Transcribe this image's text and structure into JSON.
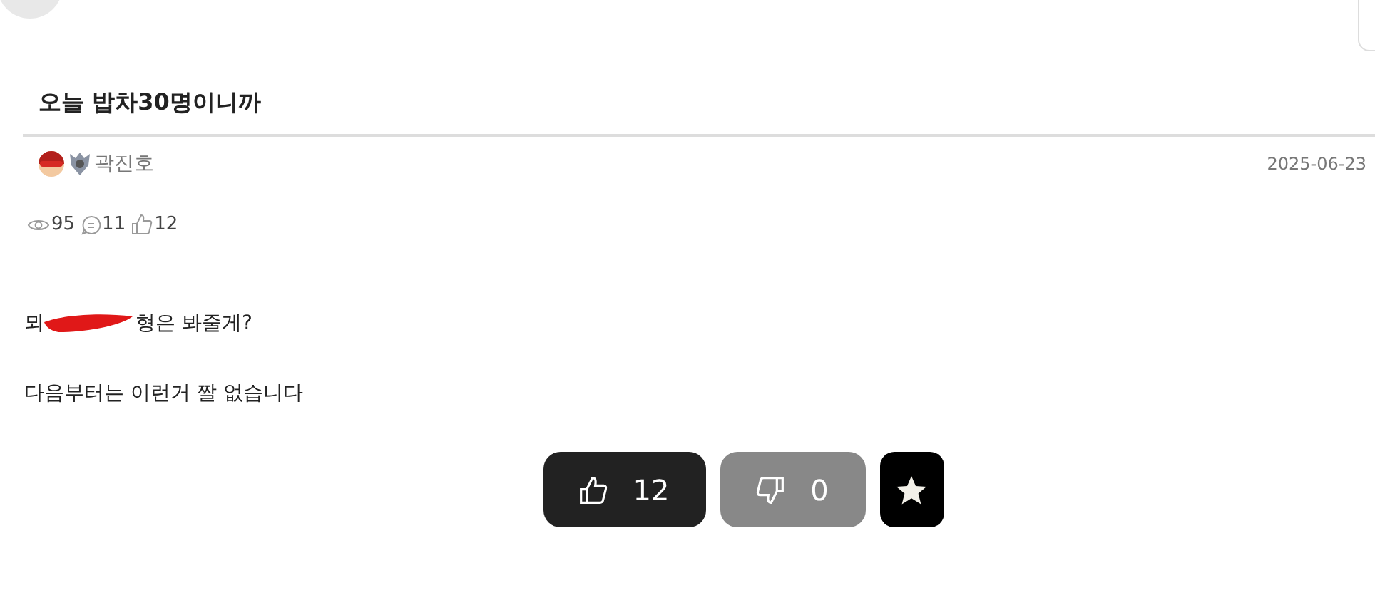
{
  "post": {
    "title": "오늘 밥차30명이니까",
    "author": "곽진호",
    "date": "2025-06-23",
    "stats": [
      {
        "kind": "views",
        "value": "95"
      },
      {
        "kind": "comments",
        "value": "11"
      },
      {
        "kind": "likes",
        "value": "12"
      }
    ],
    "body": [
      {
        "kind": "redacted",
        "before": "뫼",
        "after": "형은 봐줄게?"
      },
      {
        "kind": "plain",
        "text": "다음부터는 이런거 짤 없습니다"
      }
    ]
  },
  "votes": [
    {
      "kind": "up",
      "count": "12"
    },
    {
      "kind": "down",
      "count": "0"
    },
    {
      "kind": "bookmark"
    }
  ]
}
